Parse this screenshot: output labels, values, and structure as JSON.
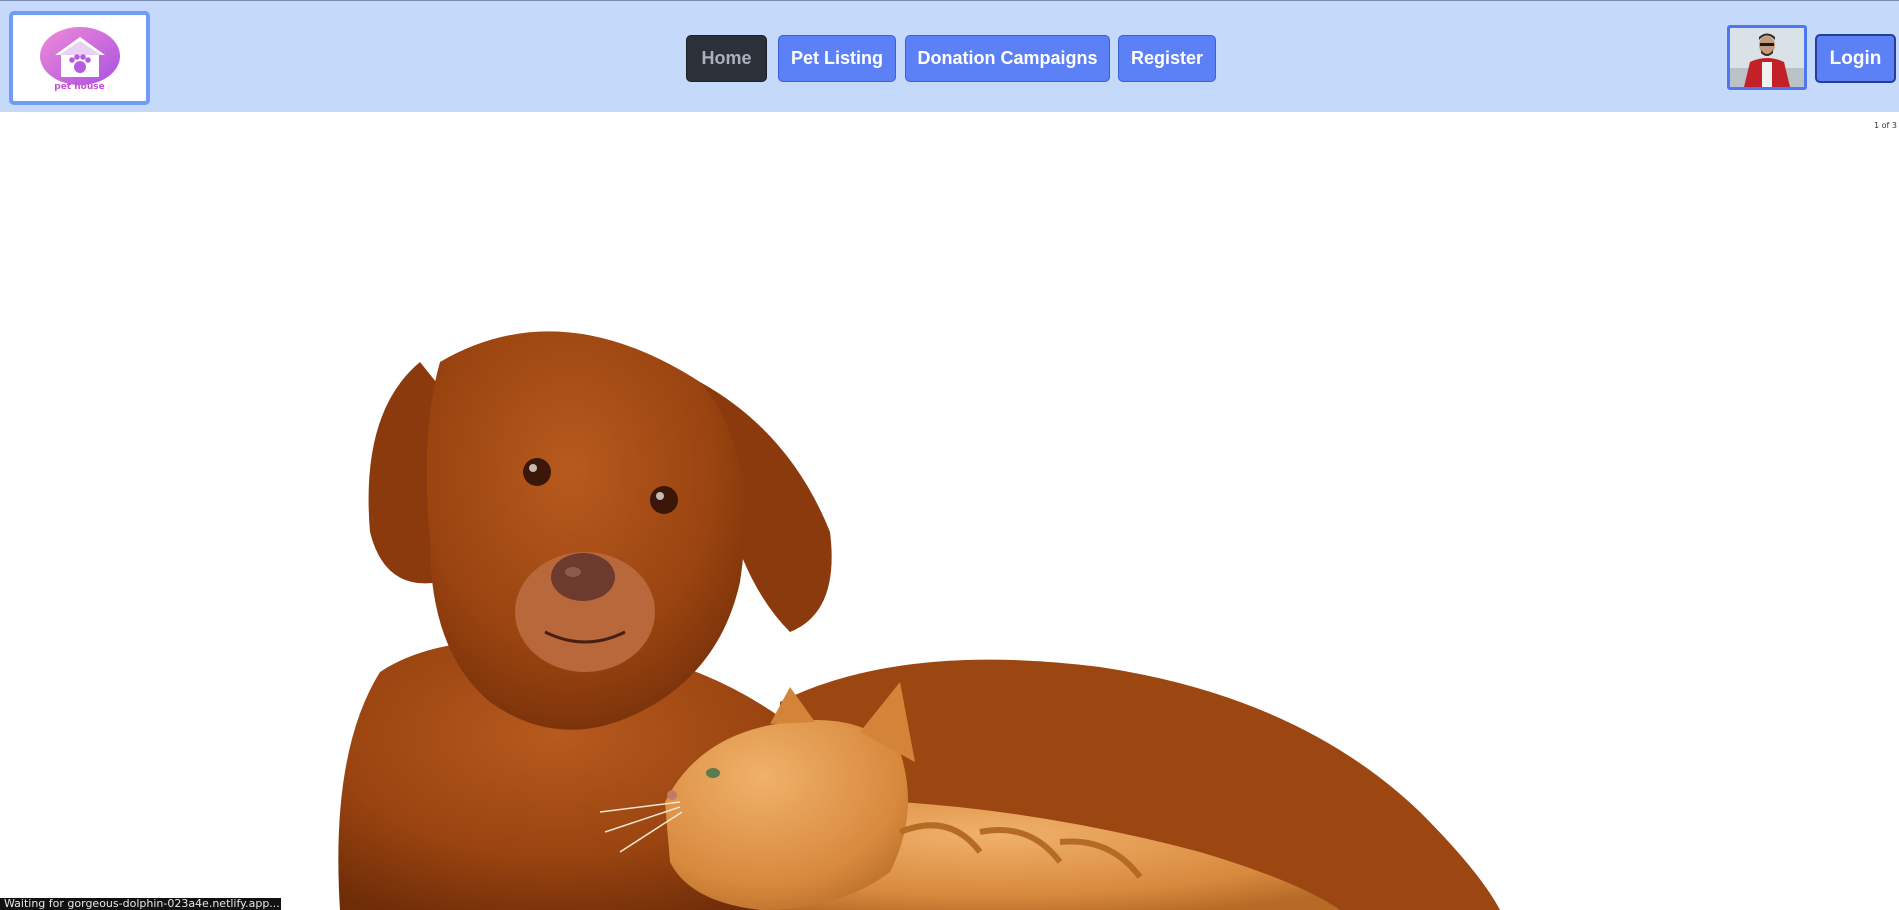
{
  "logo": {
    "text": "pet house"
  },
  "nav": {
    "items": [
      {
        "label": "Home",
        "active": true
      },
      {
        "label": "Pet Listing"
      },
      {
        "label": "Donation Campaigns"
      },
      {
        "label": "Register"
      }
    ]
  },
  "user": {
    "avatar_icon": "user-avatar"
  },
  "auth": {
    "login_label": "Login"
  },
  "carousel": {
    "counter": "1 of 3"
  },
  "status": {
    "text": "Waiting for gorgeous-dolphin-023a4e.netlify.app..."
  },
  "colors": {
    "navbar_bg": "#c5d9fb",
    "button_primary": "#5c80f5",
    "button_active": "#2b3039",
    "logo_accent": "#c64fd3"
  }
}
